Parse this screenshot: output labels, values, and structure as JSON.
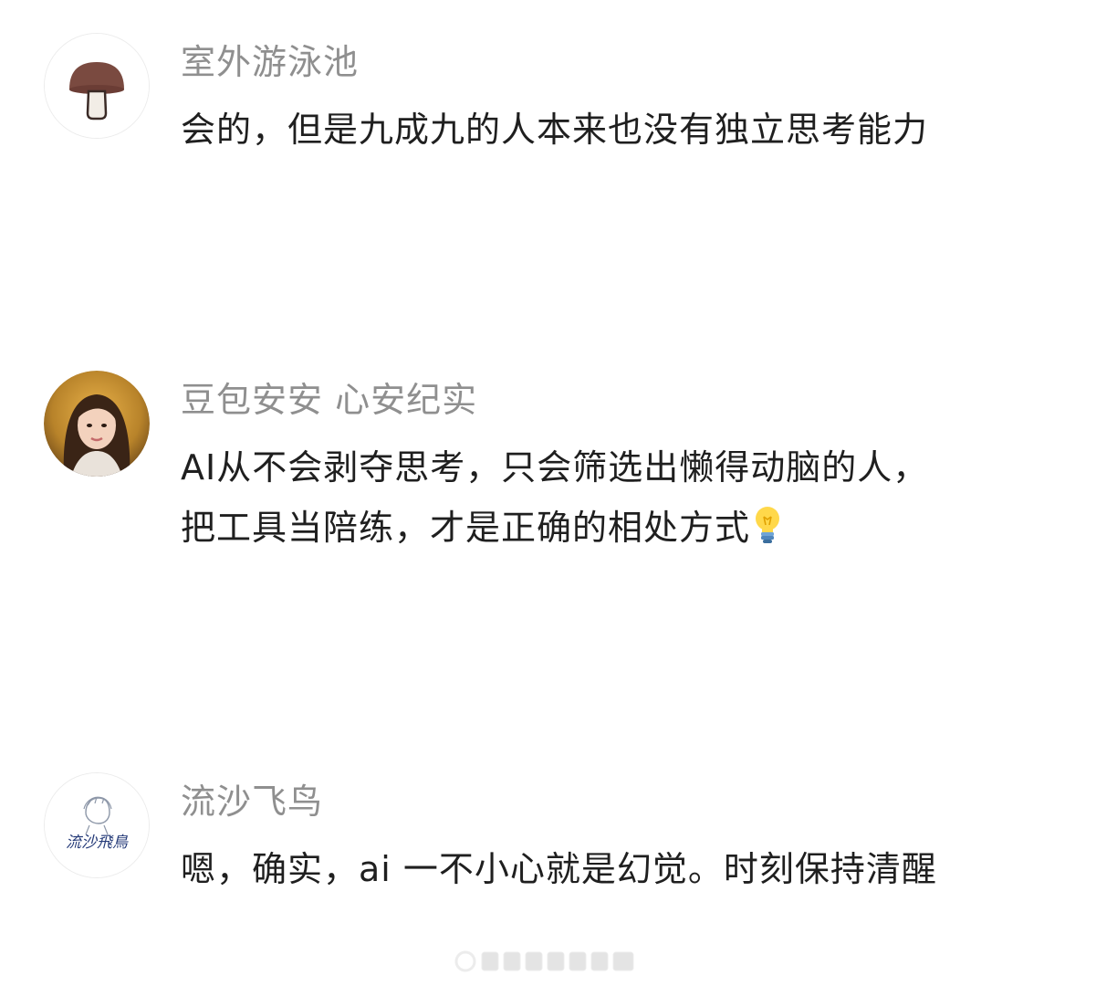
{
  "comments": [
    {
      "username": "室外游泳池",
      "avatar_icon": "mushroom-icon",
      "lines": [
        "会的，但是九成九的人本来也没有独立思考能力"
      ]
    },
    {
      "username": "豆包安安 心安纪实",
      "avatar_icon": "portrait-avatar",
      "lines": [
        "AI从不会剥夺思考，只会筛选出懒得动脑的人，",
        "把工具当陪练，才是正确的相处方式"
      ],
      "emoji": "light-bulb-icon"
    },
    {
      "username": "流沙飞鸟",
      "avatar_icon": "sketch-avatar",
      "avatar_signature": "流沙飛鳥",
      "lines": [
        "嗯，确实，ai 一不小心就是幻觉。时刻保持清醒"
      ]
    }
  ],
  "watermark": "weibo-watermark"
}
